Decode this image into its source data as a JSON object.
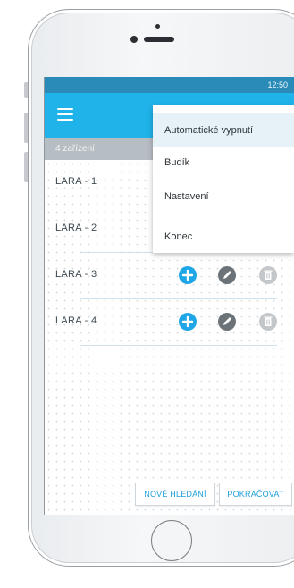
{
  "status_bar": {
    "time": "12:50"
  },
  "subheader": {
    "device_count": "4 zařízení"
  },
  "devices": [
    {
      "label": "LARA - 1"
    },
    {
      "label": "LARA - 2"
    },
    {
      "label": "LARA - 3"
    },
    {
      "label": "LARA - 4"
    }
  ],
  "buttons": {
    "new_search": "NOVÉ HLEDÁNÍ",
    "continue": "POKRAČOVAT"
  },
  "menu": {
    "items": [
      {
        "label": "Automatické vypnutí"
      },
      {
        "label": "Budík"
      },
      {
        "label": "Nastavení"
      },
      {
        "label": "Konec"
      }
    ]
  },
  "icons": {
    "menu": "hamburger-icon",
    "add": "plus-circle-icon",
    "edit": "pencil-icon",
    "delete": "trash-icon"
  },
  "colors": {
    "status_bar": "#2a8bb8",
    "app_bar": "#1fb3ea",
    "subheader": "#b6bdc3",
    "accent": "#1fa6e6",
    "edit_icon": "#6c7378",
    "delete_icon": "#c3c7ca",
    "menu_highlight": "#e6f2f8"
  }
}
